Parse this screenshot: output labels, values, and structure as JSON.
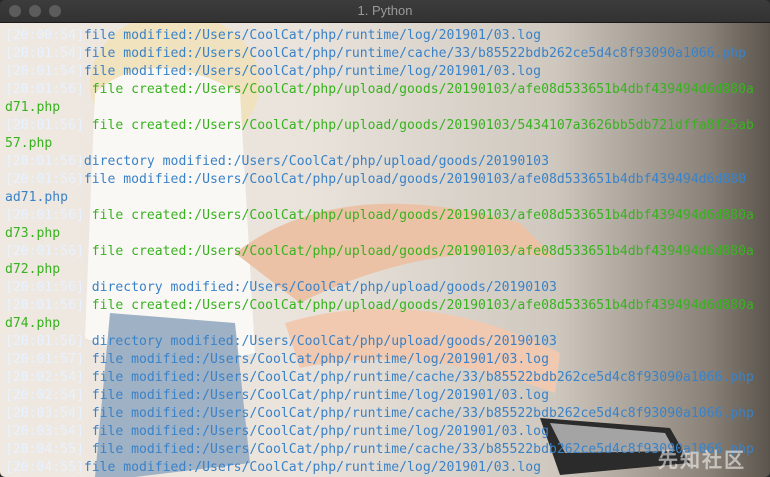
{
  "window": {
    "title": "1. Python"
  },
  "colors": {
    "timestamp": "#e8f2ff",
    "modified": "#3a82c8",
    "created": "#38b21f"
  },
  "lines": [
    {
      "ts": "[20:00:54]",
      "text": "file modified:/Users/CoolCat/php/runtime/log/201901/03.log",
      "color": "blue"
    },
    {
      "ts": "[20:01:54]",
      "text": "file modified:/Users/CoolCat/php/runtime/cache/33/b85522bdb262ce5d4c8f93090a1066.php",
      "color": "blue"
    },
    {
      "ts": "[20:01:54]",
      "text": "file modified:/Users/CoolCat/php/runtime/log/201901/03.log",
      "color": "blue"
    },
    {
      "ts": "[20:01:56]",
      "text": " file created:/Users/CoolCat/php/upload/goods/20190103/afe08d533651b4dbf439494d6d880a",
      "color": "green"
    },
    {
      "ts": "",
      "text": "d71.php",
      "color": "green"
    },
    {
      "ts": "[20:01:56]",
      "text": " file created:/Users/CoolCat/php/upload/goods/20190103/5434107a3626bb5db721dffa8f25ab",
      "color": "green"
    },
    {
      "ts": "",
      "text": "57.php",
      "color": "green"
    },
    {
      "ts": "[20:01:56]",
      "text": "directory modified:/Users/CoolCat/php/upload/goods/20190103",
      "color": "blue"
    },
    {
      "ts": "[20:01:56]",
      "text": "file modified:/Users/CoolCat/php/upload/goods/20190103/afe08d533651b4dbf439494d6d880",
      "color": "blue"
    },
    {
      "ts": "",
      "text": "ad71.php",
      "color": "blue"
    },
    {
      "ts": "[20:01:56]",
      "text": " file created:/Users/CoolCat/php/upload/goods/20190103/afe08d533651b4dbf439494d6d880a",
      "color": "green"
    },
    {
      "ts": "",
      "text": "d73.php",
      "color": "green"
    },
    {
      "ts": "[20:01:56]",
      "text": " file created:/Users/CoolCat/php/upload/goods/20190103/afe08d533651b4dbf439494d6d880a",
      "color": "green"
    },
    {
      "ts": "",
      "text": "d72.php",
      "color": "green"
    },
    {
      "ts": "[20:01:56]",
      "text": " directory modified:/Users/CoolCat/php/upload/goods/20190103",
      "color": "blue"
    },
    {
      "ts": "[20:01:56]",
      "text": " file created:/Users/CoolCat/php/upload/goods/20190103/afe08d533651b4dbf439494d6d880a",
      "color": "green"
    },
    {
      "ts": "",
      "text": "d74.php",
      "color": "green"
    },
    {
      "ts": "[20:01:56]",
      "text": " directory modified:/Users/CoolCat/php/upload/goods/20190103",
      "color": "blue"
    },
    {
      "ts": "[20:01:57]",
      "text": " file modified:/Users/CoolCat/php/runtime/log/201901/03.log",
      "color": "blue"
    },
    {
      "ts": "[20:02:54]",
      "text": " file modified:/Users/CoolCat/php/runtime/cache/33/b85522bdb262ce5d4c8f93090a1066.php",
      "color": "blue"
    },
    {
      "ts": "[20:02:54]",
      "text": " file modified:/Users/CoolCat/php/runtime/log/201901/03.log",
      "color": "blue"
    },
    {
      "ts": "[20:03:54]",
      "text": " file modified:/Users/CoolCat/php/runtime/cache/33/b85522bdb262ce5d4c8f93090a1066.php",
      "color": "blue"
    },
    {
      "ts": "[20:03:54]",
      "text": " file modified:/Users/CoolCat/php/runtime/log/201901/03.log",
      "color": "blue"
    },
    {
      "ts": "[20:04:55]",
      "text": " file modified:/Users/CoolCat/php/runtime/cache/33/b85522bdb262ce5d4c8f93090a1066.php",
      "color": "blue"
    },
    {
      "ts": "[20:04:55]",
      "text": "file modified:/Users/CoolCat/php/runtime/log/201901/03.log",
      "color": "blue"
    }
  ],
  "watermark": "先知社区"
}
